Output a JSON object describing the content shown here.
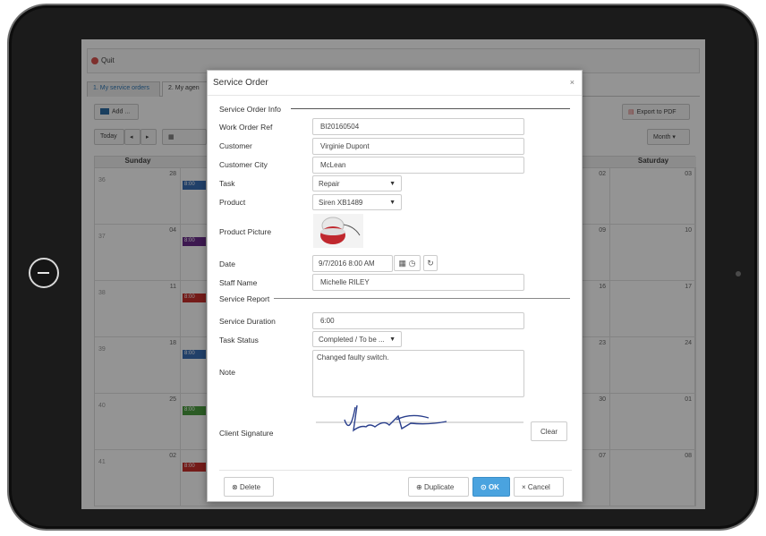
{
  "app": {
    "quit_label": "Quit",
    "tabs": [
      "1. My service orders",
      "2. My agen"
    ],
    "add_label": "Add ...",
    "export_label": "Export to PDF",
    "today_label": "Today",
    "month_label": "Month",
    "days_header": {
      "sunday": "Sunday",
      "saturday": "Saturday"
    },
    "weeks": [
      {
        "week": "36",
        "sun": "28",
        "sat": "03",
        "fri": "02"
      },
      {
        "week": "37",
        "sun": "04",
        "sat": "10",
        "fri": "09"
      },
      {
        "week": "38",
        "sun": "11",
        "sat": "17",
        "fri": "16"
      },
      {
        "week": "39",
        "sun": "18",
        "sat": "24",
        "fri": "23"
      },
      {
        "week": "40",
        "sun": "25",
        "sat": "01",
        "fri": "30"
      },
      {
        "week": "41",
        "sun": "02",
        "sat": "08",
        "fri": "07"
      }
    ],
    "event_label": "8:00"
  },
  "dialog": {
    "title": "Service Order",
    "close": "×",
    "section_info": "Service Order Info",
    "section_report": "Service Report",
    "fields": {
      "work_order_ref": {
        "label": "Work Order Ref",
        "value": "BI20160504"
      },
      "customer": {
        "label": "Customer",
        "value": "Virginie Dupont"
      },
      "customer_city": {
        "label": "Customer City",
        "value": "McLean"
      },
      "task": {
        "label": "Task",
        "value": "Repair"
      },
      "product": {
        "label": "Product",
        "value": "Siren XB1489"
      },
      "product_picture": {
        "label": "Product Picture"
      },
      "date": {
        "label": "Date",
        "value": "9/7/2016 8:00 AM"
      },
      "staff_name": {
        "label": "Staff Name",
        "value": "Michelle RILEY"
      },
      "service_duration": {
        "label": "Service Duration",
        "value": "6:00"
      },
      "task_status": {
        "label": "Task Status",
        "value": "Completed / To be ..."
      },
      "note": {
        "label": "Note",
        "value": "Changed faulty switch."
      },
      "client_signature": {
        "label": "Client Signature"
      }
    },
    "buttons": {
      "clear": "Clear",
      "delete": "Delete",
      "duplicate": "Duplicate",
      "ok": "OK",
      "cancel": "Cancel"
    }
  },
  "colors": {
    "ok": "#4aa3df",
    "quit": "#d9534f",
    "event_blue": "#3a6fb5",
    "event_purple": "#6a2c8a",
    "event_green": "#4a9e3f",
    "event_red": "#c9302c"
  }
}
